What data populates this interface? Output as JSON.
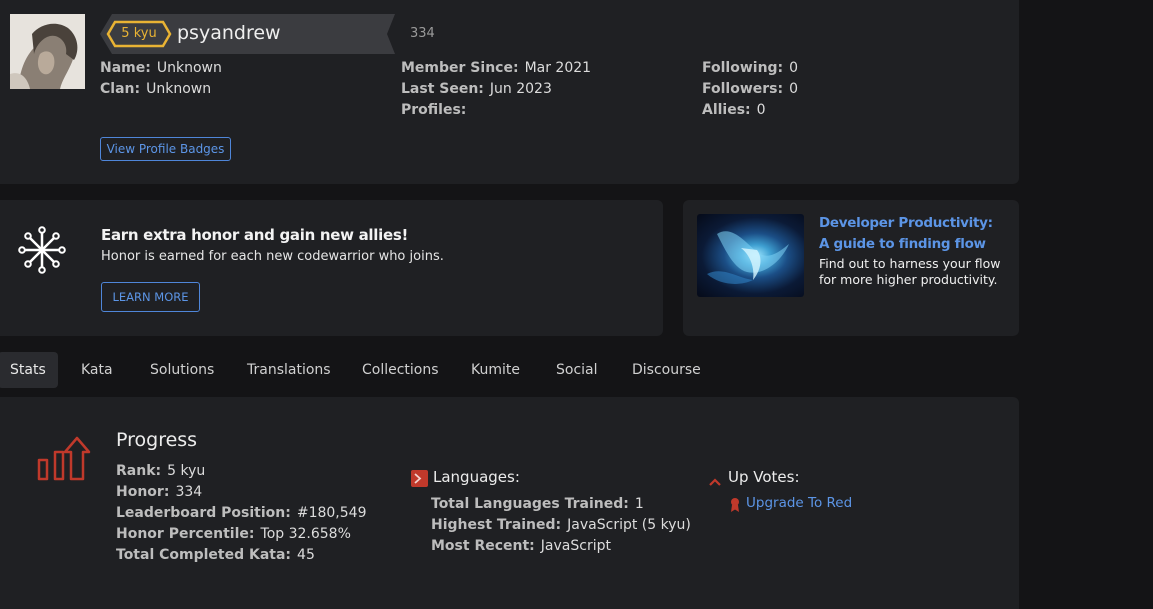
{
  "profile": {
    "rank_badge": "5 kyu",
    "username": "psyandrew",
    "honor": "334",
    "left": [
      {
        "label": "Name:",
        "value": "Unknown"
      },
      {
        "label": "Clan:",
        "value": "Unknown"
      }
    ],
    "middle": [
      {
        "label": "Member Since:",
        "value": "Mar 2021"
      },
      {
        "label": "Last Seen:",
        "value": "Jun 2023"
      },
      {
        "label": "Profiles:",
        "value": ""
      }
    ],
    "right": [
      {
        "label": "Following:",
        "value": "0"
      },
      {
        "label": "Followers:",
        "value": "0"
      },
      {
        "label": "Allies:",
        "value": "0"
      }
    ],
    "badges_button": "View Profile Badges"
  },
  "referral": {
    "title": "Earn extra honor and gain new allies!",
    "description": "Honor is earned for each new codewarrior who joins.",
    "button": "LEARN MORE"
  },
  "ad": {
    "title": "Developer Productivity: A guide to finding flow",
    "description": "Find out to harness your flow for more higher productivity."
  },
  "tabs": [
    {
      "label": "Stats"
    },
    {
      "label": "Kata"
    },
    {
      "label": "Solutions"
    },
    {
      "label": "Translations"
    },
    {
      "label": "Collections"
    },
    {
      "label": "Kumite"
    },
    {
      "label": "Social"
    },
    {
      "label": "Discourse"
    }
  ],
  "stats": {
    "progress_title": "Progress",
    "progress": [
      {
        "label": "Rank:",
        "value": "5 kyu"
      },
      {
        "label": "Honor:",
        "value": "334"
      },
      {
        "label": "Leaderboard Position:",
        "value": "#180,549"
      },
      {
        "label": "Honor Percentile:",
        "value": "Top 32.658%"
      },
      {
        "label": "Total Completed Kata:",
        "value": "45"
      }
    ],
    "languages_title": "Languages:",
    "languages": [
      {
        "label": "Total Languages Trained:",
        "value": "1"
      },
      {
        "label": "Highest Trained:",
        "value": "JavaScript (5 kyu)"
      },
      {
        "label": "Most Recent:",
        "value": "JavaScript"
      }
    ],
    "upvotes_title": "Up Votes:",
    "upgrade_link": "Upgrade To Red"
  },
  "colors": {
    "accent_blue": "#5c95e6",
    "rank_yellow": "#e9b334",
    "icon_red": "#c0392b"
  }
}
